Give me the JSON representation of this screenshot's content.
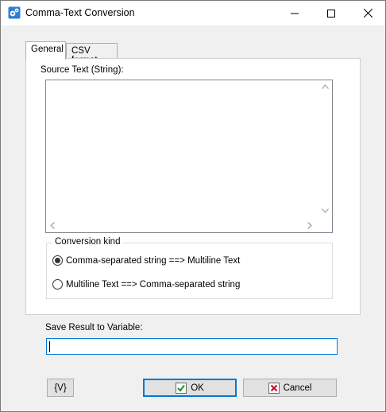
{
  "window": {
    "title": "Comma-Text Conversion"
  },
  "tabs": [
    {
      "label": "General",
      "active": true
    },
    {
      "label": "CSV format",
      "active": false
    }
  ],
  "general": {
    "source_label": "Source Text (String):",
    "source_value": "",
    "conversion_group_title": "Conversion kind",
    "options": [
      {
        "label": "Comma-separated string ==> Multiline Text",
        "selected": true
      },
      {
        "label": "Multiline Text ==> Comma-separated string",
        "selected": false
      }
    ]
  },
  "save": {
    "label": "Save Result to Variable:",
    "value": ""
  },
  "buttons": {
    "variable_label": "{V}",
    "ok_label": "OK",
    "cancel_label": "Cancel"
  },
  "colors": {
    "accent": "#0078d7",
    "ok_icon": "#1c9c2c",
    "cancel_icon": "#d0021b"
  },
  "icons": {
    "app": "app-gears-icon",
    "minimize": "minimize-icon",
    "maximize": "maximize-icon",
    "close": "close-icon",
    "ok": "checkmark-icon",
    "cancel": "x-mark-icon"
  }
}
